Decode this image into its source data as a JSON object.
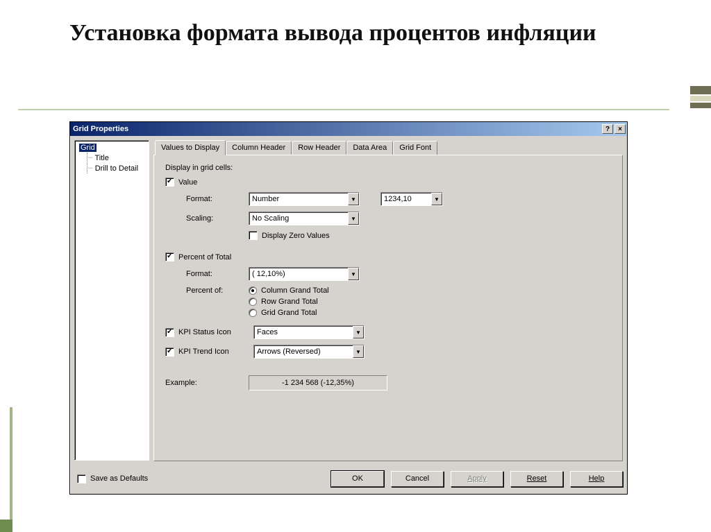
{
  "slide": {
    "title": "Установка формата вывода процентов инфляции"
  },
  "dialog": {
    "title": "Grid Properties",
    "help_btn": "?",
    "close_btn": "×",
    "tree": {
      "items": [
        "Grid",
        "Title",
        "Drill to Detail"
      ],
      "selected": "Grid"
    },
    "tabs": [
      "Values to Display",
      "Column Header",
      "Row Header",
      "Data Area",
      "Grid Font"
    ],
    "active_tab": "Values to Display",
    "page": {
      "display_label": "Display in grid cells:",
      "value_check": "Value",
      "format_label": "Format:",
      "format_value": "Number",
      "decimals_value": "1234,10",
      "scaling_label": "Scaling:",
      "scaling_value": "No Scaling",
      "display_zero": "Display Zero Values",
      "percent_check": "Percent of Total",
      "pformat_label": "Format:",
      "pformat_value": "( 12,10%)",
      "percentof_label": "Percent of:",
      "radio_col": "Column Grand Total",
      "radio_row": "Row Grand Total",
      "radio_grid": "Grid Grand Total",
      "kpi_status": "KPI Status Icon",
      "kpi_status_value": "Faces",
      "kpi_trend": "KPI Trend Icon",
      "kpi_trend_value": "Arrows (Reversed)",
      "example_label": "Example:",
      "example_value": "-1 234 568   (-12,35%)"
    },
    "footer": {
      "save_defaults": "Save as Defaults",
      "ok": "OK",
      "cancel": "Cancel",
      "apply": "Apply",
      "reset": "Reset",
      "help": "Help"
    }
  }
}
